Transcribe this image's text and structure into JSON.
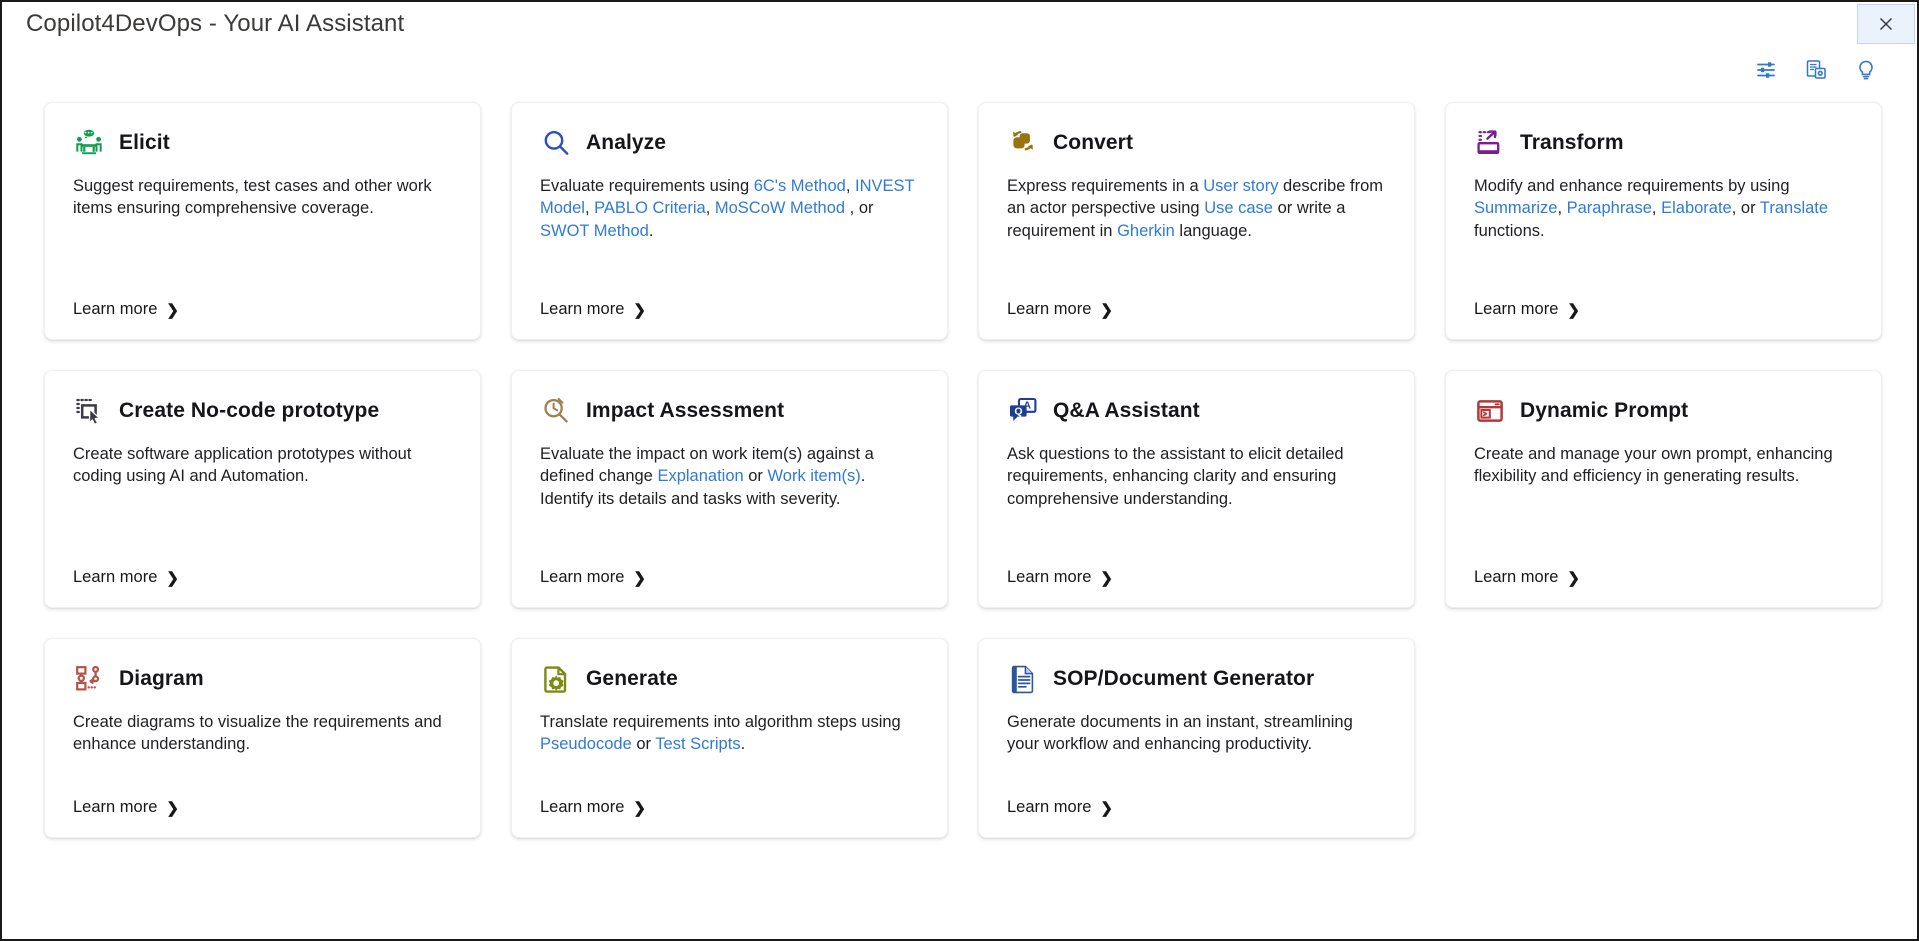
{
  "window": {
    "title": "Copilot4DevOps - Your AI Assistant",
    "close_label": "×"
  },
  "toolbar": {
    "icons": [
      {
        "name": "settings-sliders-icon",
        "label": "Settings"
      },
      {
        "name": "document-settings-icon",
        "label": "Document settings"
      },
      {
        "name": "lightbulb-icon",
        "label": "Tips"
      }
    ],
    "accent_color": "#2f77c9"
  },
  "link_color": "#2f7bd4",
  "learn_more_label": "Learn more",
  "chevron": "❯",
  "cards": [
    {
      "id": "elicit",
      "title": "Elicit",
      "icon": "elicit-people-icon",
      "icon_color": "#0f9d4f",
      "size": "tall",
      "desc_parts": [
        {
          "t": "Suggest requirements, test cases and other work items ensuring comprehensive coverage.",
          "link": false
        }
      ]
    },
    {
      "id": "analyze",
      "title": "Analyze",
      "icon": "magnifier-icon",
      "icon_color": "#2b4fc0",
      "size": "tall",
      "desc_parts": [
        {
          "t": "Evaluate requirements using ",
          "link": false
        },
        {
          "t": "6C's Method",
          "link": true
        },
        {
          "t": ", ",
          "link": false
        },
        {
          "t": "INVEST Model",
          "link": true
        },
        {
          "t": ", ",
          "link": false
        },
        {
          "t": "PABLO Criteria",
          "link": true
        },
        {
          "t": ", ",
          "link": false
        },
        {
          "t": "MoSCoW Method",
          "link": true
        },
        {
          "t": " , or ",
          "link": false
        },
        {
          "t": "SWOT Method",
          "link": true
        },
        {
          "t": ".",
          "link": false
        }
      ]
    },
    {
      "id": "convert",
      "title": "Convert",
      "icon": "convert-arrows-icon",
      "icon_color": "#9a7212",
      "size": "tall",
      "desc_parts": [
        {
          "t": "Express requirements in a ",
          "link": false
        },
        {
          "t": "User story",
          "link": true
        },
        {
          "t": "  describe from an actor perspective using ",
          "link": false
        },
        {
          "t": "Use case",
          "link": true
        },
        {
          "t": "  or write a requirement in ",
          "link": false
        },
        {
          "t": "Gherkin",
          "link": true
        },
        {
          "t": "  language.",
          "link": false
        }
      ]
    },
    {
      "id": "transform",
      "title": "Transform",
      "icon": "transform-icon",
      "icon_color": "#7a1f8f",
      "size": "tall",
      "desc_parts": [
        {
          "t": "Modify and enhance requirements by using ",
          "link": false
        },
        {
          "t": "Summarize",
          "link": true
        },
        {
          "t": ", ",
          "link": false
        },
        {
          "t": "Paraphrase",
          "link": true
        },
        {
          "t": ", ",
          "link": false
        },
        {
          "t": "Elaborate",
          "link": true
        },
        {
          "t": ", or ",
          "link": false
        },
        {
          "t": "Translate",
          "link": true
        },
        {
          "t": " functions.",
          "link": false
        }
      ]
    },
    {
      "id": "create-no-code-prototype",
      "title": "Create No-code prototype",
      "icon": "no-code-cursor-icon",
      "icon_color": "#3b3a45",
      "size": "tall",
      "desc_parts": [
        {
          "t": "Create software application prototypes without coding using AI and Automation.",
          "link": false
        }
      ]
    },
    {
      "id": "impact-assessment",
      "title": "Impact Assessment",
      "icon": "impact-magnifier-clock-icon",
      "icon_color": "#a08050",
      "size": "tall",
      "desc_parts": [
        {
          "t": "Evaluate the impact on work item(s) against a defined change ",
          "link": false
        },
        {
          "t": "Explanation",
          "link": true
        },
        {
          "t": " or ",
          "link": false
        },
        {
          "t": "Work item(s)",
          "link": true
        },
        {
          "t": ". Identify its details and tasks with severity.",
          "link": false
        }
      ]
    },
    {
      "id": "qa-assistant",
      "title": "Q&A Assistant",
      "icon": "qa-chat-icon",
      "icon_color": "#1f3e92",
      "size": "tall",
      "desc_parts": [
        {
          "t": "Ask questions to the assistant to elicit detailed requirements, enhancing clarity and ensuring comprehensive understanding.",
          "link": false
        }
      ]
    },
    {
      "id": "dynamic-prompt",
      "title": "Dynamic Prompt",
      "icon": "terminal-window-icon",
      "icon_color": "#b13a3a",
      "size": "tall",
      "desc_parts": [
        {
          "t": "Create and manage your own prompt, enhancing flexibility and efficiency in generating results.",
          "link": false
        }
      ]
    },
    {
      "id": "diagram",
      "title": "Diagram",
      "icon": "diagram-nodes-icon",
      "icon_color": "#b3544a",
      "size": "short",
      "desc_parts": [
        {
          "t": "Create diagrams to visualize the requirements and enhance understanding.",
          "link": false
        }
      ]
    },
    {
      "id": "generate",
      "title": "Generate",
      "icon": "document-gear-icon",
      "icon_color": "#7d8a12",
      "size": "short",
      "desc_parts": [
        {
          "t": "Translate requirements into algorithm steps using ",
          "link": false
        },
        {
          "t": "Pseudocode",
          "link": true
        },
        {
          "t": " or ",
          "link": false
        },
        {
          "t": "Test Scripts",
          "link": true
        },
        {
          "t": ".",
          "link": false
        }
      ]
    },
    {
      "id": "sop-document-generator",
      "title": "SOP/Document Generator",
      "icon": "word-document-icon",
      "icon_color": "#2b579a",
      "size": "short",
      "desc_parts": [
        {
          "t": "Generate documents in an instant, streamlining your workflow and enhancing productivity.",
          "link": false
        }
      ]
    }
  ]
}
